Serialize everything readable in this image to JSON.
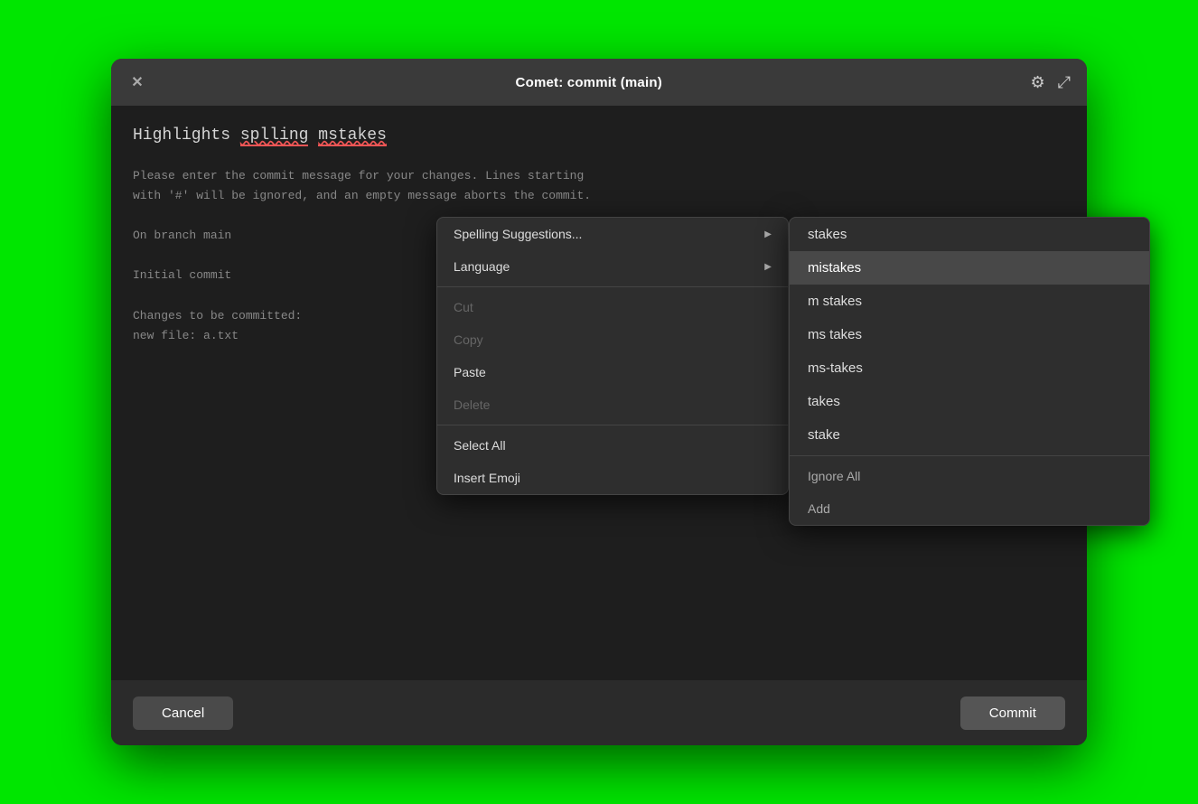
{
  "window": {
    "title": "Comet: commit (main)",
    "close_label": "✕"
  },
  "icons": {
    "gear": "⚙",
    "expand": "⤢"
  },
  "editor": {
    "line1_prefix": "Highlights ",
    "misspelled1": "splling",
    "misspelled2": "mstakes",
    "comment_lines": [
      "Please enter the commit message for your changes. Lines starting",
      "with '#' will be ignored, and an empty message aborts the commit.",
      "",
      "On branch main",
      "",
      "Initial commit",
      "",
      "Changes to be committed:",
      "    new file:   a.txt"
    ]
  },
  "context_menu": {
    "items": [
      {
        "label": "Spelling Suggestions...",
        "has_arrow": true,
        "disabled": false
      },
      {
        "label": "Language",
        "has_arrow": true,
        "disabled": false
      }
    ],
    "items2": [
      {
        "label": "Cut",
        "disabled": true
      },
      {
        "label": "Copy",
        "disabled": true
      },
      {
        "label": "Paste",
        "disabled": false
      },
      {
        "label": "Delete",
        "disabled": true
      }
    ],
    "items3": [
      {
        "label": "Select All",
        "disabled": false
      },
      {
        "label": "Insert Emoji",
        "disabled": false
      }
    ]
  },
  "spell_submenu": {
    "suggestions": [
      "stakes",
      "mistakes",
      "m stakes",
      "ms takes",
      "ms-takes",
      "takes",
      "stake"
    ],
    "active_index": 1,
    "actions": [
      "Ignore All",
      "Add"
    ]
  },
  "footer": {
    "cancel_label": "Cancel",
    "commit_label": "Commit"
  }
}
